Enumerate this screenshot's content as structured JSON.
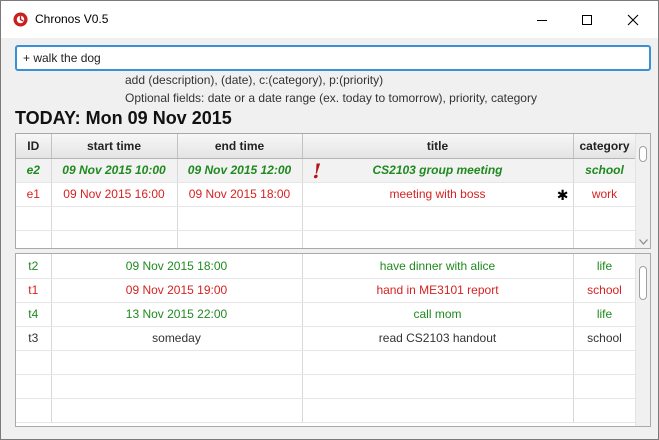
{
  "window": {
    "title": "Chronos V0.5"
  },
  "command": {
    "value": "+ walk the dog",
    "hint_line1": "add (description), (date), c:(category), p:(priority)",
    "hint_line2": "Optional fields: date or a date range (ex. today to tomorrow), priority, category"
  },
  "today_label": "TODAY: Mon 09 Nov 2015",
  "table": {
    "headers": [
      "ID",
      "start time",
      "end time",
      "title",
      "category"
    ]
  },
  "events": [
    {
      "id": "e2",
      "start": "09 Nov 2015 10:00",
      "end": "09 Nov 2015 12:00",
      "title": "CS2103 group meeting",
      "category": "school",
      "color": "#1f8a1f",
      "priority_flag": "!"
    },
    {
      "id": "e1",
      "start": "09 Nov 2015 16:00",
      "end": "09 Nov 2015 18:00",
      "title": "meeting with boss",
      "category": "work",
      "color": "#d62222",
      "marker": "✱"
    }
  ],
  "tasks": [
    {
      "id": "t2",
      "due": "09 Nov 2015 18:00",
      "title": "have dinner with alice",
      "category": "life",
      "color": "#1f8a1f"
    },
    {
      "id": "t1",
      "due": "09 Nov 2015 19:00",
      "title": "hand in ME3101 report",
      "category": "school",
      "color": "#d62222"
    },
    {
      "id": "t4",
      "due": "13 Nov 2015 22:00",
      "title": "call mom",
      "category": "life",
      "color": "#1f8a1f"
    },
    {
      "id": "t3",
      "due": "someday",
      "title": "read CS2103 handout",
      "category": "school",
      "color": "#333333"
    }
  ],
  "colors": {
    "accent": "#3a8fd6",
    "green": "#1f8a1f",
    "red": "#d62222"
  }
}
